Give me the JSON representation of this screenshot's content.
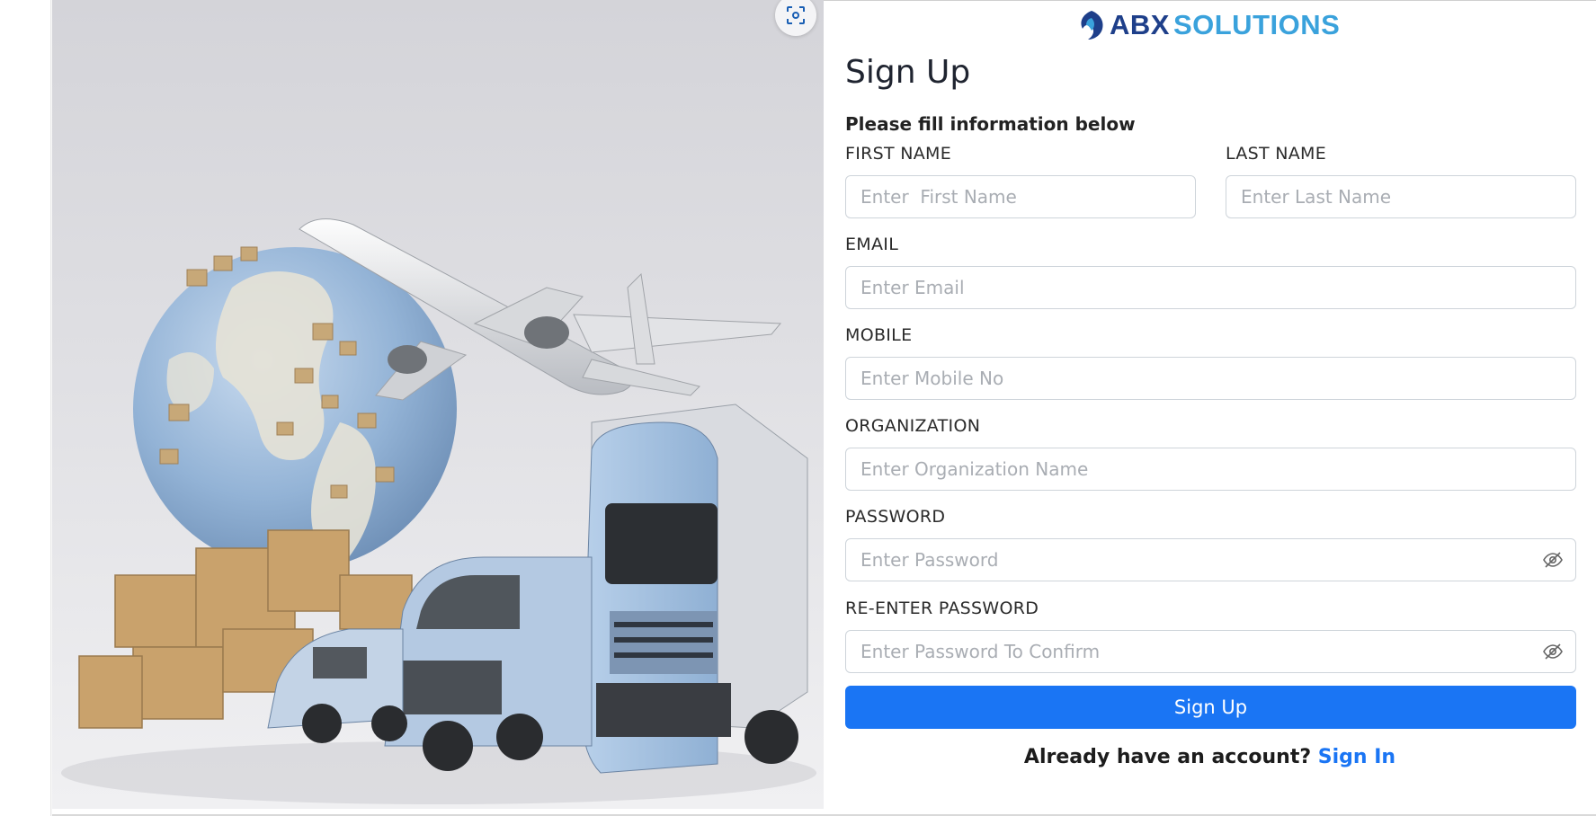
{
  "brand": {
    "logo_part1": "ABX",
    "logo_part2": "SOLUTIONS",
    "colors": {
      "dark_blue": "#1e3f8a",
      "light_blue": "#3aa2dc"
    }
  },
  "hero": {
    "icon": "scan-icon"
  },
  "form": {
    "title": "Sign Up",
    "subtitle": "Please fill information below",
    "first_name": {
      "label": "FIRST NAME",
      "placeholder": "Enter  First Name",
      "value": ""
    },
    "last_name": {
      "label": "LAST NAME",
      "placeholder": "Enter Last Name",
      "value": ""
    },
    "email": {
      "label": "EMAIL",
      "placeholder": "Enter Email",
      "value": ""
    },
    "mobile": {
      "label": "MOBILE",
      "placeholder": "Enter Mobile No",
      "value": ""
    },
    "organization": {
      "label": "ORGANIZATION",
      "placeholder": "Enter Organization Name",
      "value": ""
    },
    "password": {
      "label": "PASSWORD",
      "placeholder": "Enter Password",
      "value": "",
      "icon": "eye-slash-icon"
    },
    "confirm_password": {
      "label": "RE-ENTER PASSWORD",
      "placeholder": "Enter Password To Confirm",
      "value": "",
      "icon": "eye-slash-icon"
    },
    "submit_label": "Sign Up",
    "submit_color": "#1a75f4",
    "signin_prompt": "Already have an account?",
    "signin_link": "Sign In"
  }
}
